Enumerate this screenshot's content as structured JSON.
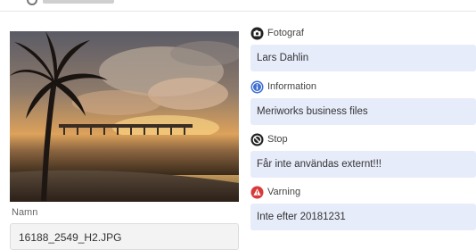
{
  "fields": [
    {
      "icon": "camera-icon",
      "label": "Fotograf",
      "value": "Lars Dahlin",
      "accent": "#222222"
    },
    {
      "icon": "info-icon",
      "label": "Information",
      "value": "Meriworks business files",
      "accent": "#3d6fd0"
    },
    {
      "icon": "stop-icon",
      "label": "Stop",
      "value": "Får inte användas externt!!!",
      "accent": "#222222"
    },
    {
      "icon": "warning-icon",
      "label": "Varning",
      "value": "Inte efter 20181231",
      "accent": "#d83a3a"
    }
  ],
  "image": {
    "subject": "palm tree and bridge at sunset"
  },
  "name_field": {
    "label": "Namn",
    "value": "16188_2549_H2.JPG"
  },
  "colors": {
    "value_bg": "#e7ecfa",
    "name_bg": "#f3f3f3"
  }
}
